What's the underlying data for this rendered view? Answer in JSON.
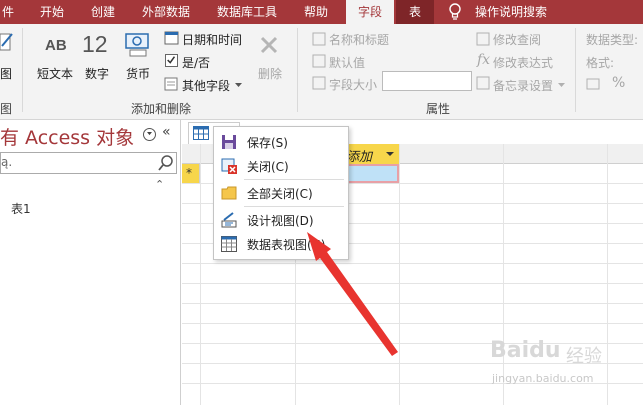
{
  "ribbon_tabs": [
    {
      "label": "件",
      "state": "normal"
    },
    {
      "label": "开始",
      "state": "normal"
    },
    {
      "label": "创建",
      "state": "normal"
    },
    {
      "label": "外部数据",
      "state": "normal"
    },
    {
      "label": "数据库工具",
      "state": "normal"
    },
    {
      "label": "帮助",
      "state": "normal"
    },
    {
      "label": "字段",
      "state": "active"
    },
    {
      "label": "表",
      "state": "context"
    }
  ],
  "tell_me": "操作说明搜索",
  "ribbon": {
    "view_group_fragment": "图",
    "view_group_label_fragment": "图",
    "add_delete": {
      "short_text": "短文本",
      "short_text_glyph": "AB",
      "number": "数字",
      "number_glyph": "12",
      "currency": "货币",
      "date_time": "日期和时间",
      "yes_no": "是/否",
      "yes_no_checked": true,
      "more_fields": "其他字段",
      "delete": "删除",
      "group_label": "添加和删除"
    },
    "properties": {
      "name_caption": "名称和标题",
      "default_value": "默认值",
      "field_size": "字段大小",
      "field_size_value": "",
      "modify_lookups": "修改查阅",
      "modify_expression": "修改表达式",
      "memo_settings": "备忘录设置",
      "group_label": "属性"
    },
    "formatting": {
      "data_type": "数据类型:",
      "format": "格式:",
      "percent": "%"
    }
  },
  "nav_pane": {
    "title": "有 Access 对象",
    "search_placeholder": "ą.",
    "items": [
      "表1"
    ]
  },
  "datasheet": {
    "add_column_label": "添加",
    "new_record_marker": "*"
  },
  "context_menu": {
    "items": [
      {
        "label": "保存(S)",
        "icon": "save-icon"
      },
      {
        "label": "关闭(C)",
        "icon": "close-icon"
      },
      {
        "label": "全部关闭(C)",
        "icon": "folder-icon"
      },
      {
        "label": "设计视图(D)",
        "icon": "design-view-icon"
      },
      {
        "label": "数据表视图(H)",
        "icon": "datasheet-view-icon"
      }
    ]
  },
  "watermark": {
    "brand": "Baidu",
    "cn": "经验",
    "site": "jingyan.baidu.com"
  },
  "colors": {
    "access_red": "#a4373a",
    "highlight_yellow": "#f7d64b",
    "arrow_red": "#e8342f"
  }
}
